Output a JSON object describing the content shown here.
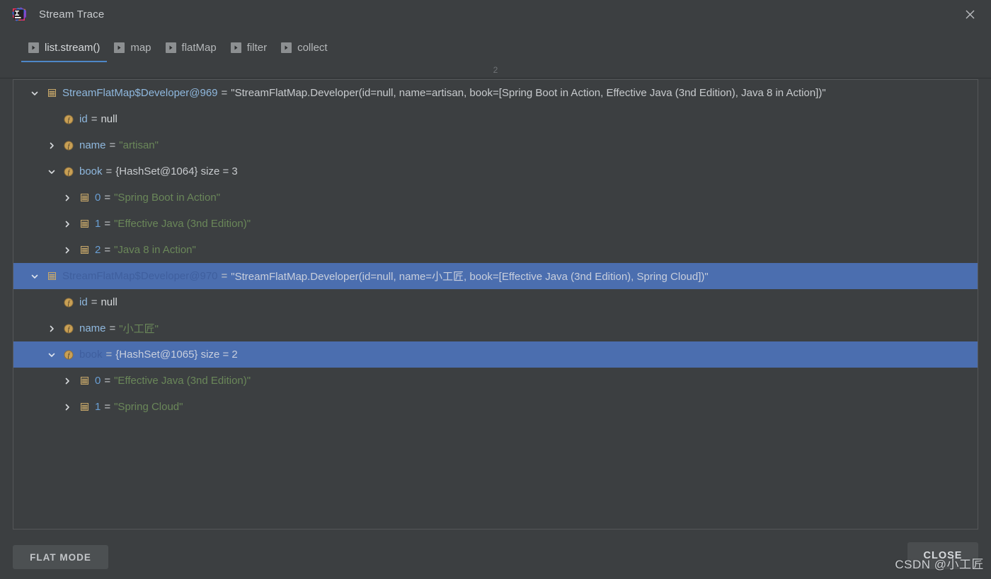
{
  "window": {
    "title": "Stream Trace",
    "logo_icon": "intellij-idea-logo",
    "close_icon": "close-icon"
  },
  "tabs": {
    "items": [
      {
        "label": "list.stream()",
        "icon": "play-arrow-icon",
        "selected": true
      },
      {
        "label": "map",
        "icon": "play-arrow-icon",
        "selected": false
      },
      {
        "label": "flatMap",
        "icon": "play-arrow-icon",
        "selected": false
      },
      {
        "label": "filter",
        "icon": "play-arrow-icon",
        "selected": false
      },
      {
        "label": "collect",
        "icon": "play-arrow-icon",
        "selected": false
      }
    ]
  },
  "counter": {
    "value": "2"
  },
  "tree": {
    "rows": [
      {
        "level": 0,
        "twisty": "chevron-down-icon",
        "icon": "object-instance-icon",
        "name": "StreamFlatMap$Developer@969",
        "eq": "=",
        "value": "\"StreamFlatMap.Developer(id=null, name=artisan, book=[Spring Boot in Action, Effective Java (3nd Edition), Java 8 in Action])\"",
        "value_kind": "plain",
        "selected": false
      },
      {
        "level": 1,
        "twisty": "none",
        "icon": "field-icon",
        "name": "id",
        "eq": "=",
        "value": "null",
        "value_kind": "null",
        "selected": false
      },
      {
        "level": 1,
        "twisty": "chevron-right-icon",
        "icon": "field-icon",
        "name": "name",
        "eq": "=",
        "value": "\"artisan\"",
        "value_kind": "string",
        "selected": false
      },
      {
        "level": 1,
        "twisty": "chevron-down-icon",
        "icon": "field-icon",
        "name": "book",
        "eq": "=",
        "value": "{HashSet@1064}  size = 3",
        "value_kind": "plain",
        "selected": false
      },
      {
        "level": 2,
        "twisty": "chevron-right-icon",
        "icon": "object-instance-icon",
        "name": "0",
        "eq": "=",
        "value": "\"Spring Boot in Action\"",
        "value_kind": "string",
        "selected": false
      },
      {
        "level": 2,
        "twisty": "chevron-right-icon",
        "icon": "object-instance-icon",
        "name": "1",
        "eq": "=",
        "value": "\"Effective Java (3nd Edition)\"",
        "value_kind": "string",
        "selected": false
      },
      {
        "level": 2,
        "twisty": "chevron-right-icon",
        "icon": "object-instance-icon",
        "name": "2",
        "eq": "=",
        "value": "\"Java 8 in Action\"",
        "value_kind": "string",
        "selected": false
      },
      {
        "level": 0,
        "twisty": "chevron-down-icon",
        "icon": "object-instance-icon",
        "name": "StreamFlatMap$Developer@970",
        "eq": "=",
        "value": "\"StreamFlatMap.Developer(id=null, name=小工匠, book=[Effective Java (3nd Edition), Spring Cloud])\"",
        "value_kind": "on-selection",
        "selected": true
      },
      {
        "level": 1,
        "twisty": "none",
        "icon": "field-icon",
        "name": "id",
        "eq": "=",
        "value": "null",
        "value_kind": "null",
        "selected": false
      },
      {
        "level": 1,
        "twisty": "chevron-right-icon",
        "icon": "field-icon",
        "name": "name",
        "eq": "=",
        "value": "\"小工匠\"",
        "value_kind": "string",
        "selected": false
      },
      {
        "level": 1,
        "twisty": "chevron-down-icon",
        "icon": "field-icon",
        "name": "book",
        "eq": "=",
        "value": "{HashSet@1065}  size = 2",
        "value_kind": "on-selection",
        "selected": true
      },
      {
        "level": 2,
        "twisty": "chevron-right-icon",
        "icon": "object-instance-icon",
        "name": "0",
        "eq": "=",
        "value": "\"Effective Java (3nd Edition)\"",
        "value_kind": "string",
        "selected": false
      },
      {
        "level": 2,
        "twisty": "chevron-right-icon",
        "icon": "object-instance-icon",
        "name": "1",
        "eq": "=",
        "value": "\"Spring Cloud\"",
        "value_kind": "string",
        "selected": false
      }
    ]
  },
  "footer": {
    "flat_mode_label": "FLAT MODE",
    "close_label": "CLOSE"
  },
  "watermark": {
    "text": "CSDN @小工匠"
  },
  "colors": {
    "background": "#3c3f41",
    "selection": "#4b6eaf",
    "tab_underline": "#4e87c7",
    "field_name": "#8fb8de",
    "string_value": "#6a8759",
    "icon_gold": "#c9a96a"
  }
}
